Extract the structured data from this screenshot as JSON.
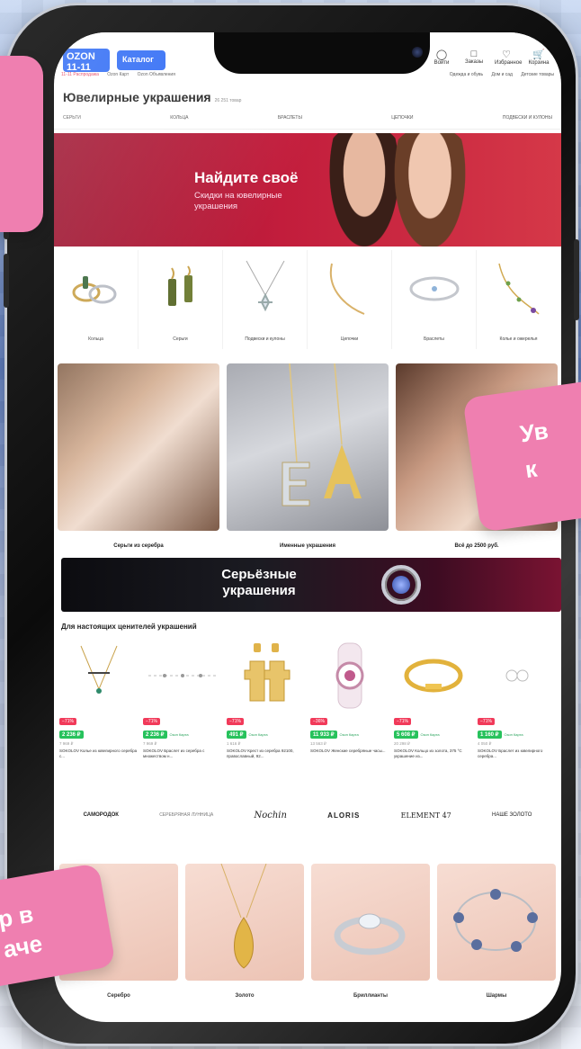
{
  "header": {
    "logo_text": "OZON 11-11",
    "catalog_label": "Каталог",
    "icons": [
      {
        "icon": "login-icon",
        "label": "Войти"
      },
      {
        "icon": "orders-icon",
        "label": "Заказы"
      },
      {
        "icon": "favorites-icon",
        "label": "Избранное"
      },
      {
        "icon": "cart-icon",
        "label": "Корзина"
      }
    ],
    "subnav_left": [
      "11-11 Распродажа",
      "Ozon Карт",
      "Ozon Объявления"
    ],
    "subnav_right": [
      "Одежда и обувь",
      "Дом и сад",
      "Детские товары"
    ]
  },
  "page": {
    "title": "Ювелирные украшения",
    "count": "26 251 товар"
  },
  "category_tabs": [
    "СЕРЬГИ",
    "КОЛЬЦА",
    "БРАСЛЕТЫ",
    "ЦЕПОЧКИ",
    "ПОДВЕСКИ И КУЛОНЫ"
  ],
  "hero": {
    "title": "Найдите своё",
    "subtitle": "Скидки на ювелирные украшения"
  },
  "categories": [
    {
      "label": "Кольца",
      "icon": "rings-icon"
    },
    {
      "label": "Серьги",
      "icon": "earrings-icon"
    },
    {
      "label": "Подвески и кулоны",
      "icon": "pendant-icon"
    },
    {
      "label": "Цепочки",
      "icon": "chain-icon"
    },
    {
      "label": "Браслеты",
      "icon": "bracelet-icon"
    },
    {
      "label": "Колье и ожерелья",
      "icon": "necklace-icon"
    }
  ],
  "feature_cards": [
    {
      "label": "Серьги из серебра"
    },
    {
      "label": "Именные украшения"
    },
    {
      "label": "Всё до 2500 руб."
    }
  ],
  "serious_banner": {
    "title": "Серьёзные украшения"
  },
  "section": {
    "heading": "Для настоящих ценителей украшений"
  },
  "products": [
    {
      "discount": "−71%",
      "price": "2 236 ₽",
      "note": "",
      "old": "7 969 ₽",
      "name": "SOKOLOV Колье из ювелирного серебра с..."
    },
    {
      "discount": "−71%",
      "price": "2 236 ₽",
      "note": "Озон Карта",
      "old": "7 969 ₽",
      "name": "SOKOLOV Браслет из серебра с множеством н..."
    },
    {
      "discount": "−71%",
      "price": "491 ₽",
      "note": "Озон Карта",
      "old": "1 616 ₽",
      "name": "SOKOLOV Крест из серебра 92100, православный, 92..."
    },
    {
      "discount": "−36%",
      "price": "11 933 ₽",
      "note": "Озон Карта",
      "old": "13 563 ₽",
      "name": "SOKOLOV Женские серебряные часы..."
    },
    {
      "discount": "−71%",
      "price": "5 608 ₽",
      "note": "Озон Карта",
      "old": "20 298 ₽",
      "name": "SOKOLOV Кольцо из золота, 375 °C украшение из..."
    },
    {
      "discount": "−71%",
      "price": "1 160 ₽",
      "note": "Озон Карта",
      "old": "4 050 ₽",
      "name": "SOKOLOV Браслет из ювелирного серебра..."
    }
  ],
  "brands": [
    "САМОРОДОК",
    "СЕРЕБРЯНАЯ ЛУННИЦА",
    "Nochin",
    "ALORIS",
    "ELEMENT 47",
    "НАШЕ ЗОЛОТО"
  ],
  "tiles": [
    {
      "label": "Серебро"
    },
    {
      "label": "Золото"
    },
    {
      "label": "Бриллианты"
    },
    {
      "label": "Шармы"
    }
  ],
  "stickers": {
    "right": "Ув\nк",
    "bottom": "р в\nаче"
  },
  "colors": {
    "accent_blue": "#2f6bf5",
    "sale_green": "#27c25c",
    "discount_red": "#f13a5a",
    "sticker_pink": "#ef7fb0",
    "hero_red": "#c21d3c"
  }
}
